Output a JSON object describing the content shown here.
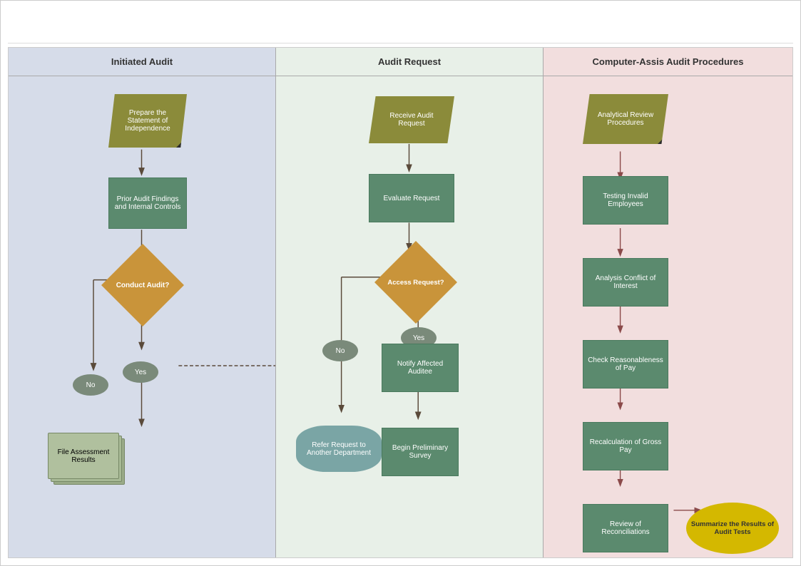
{
  "diagram": {
    "lanes": [
      {
        "id": "initiated",
        "header": "Initiated Audit",
        "color": "#d6dce9"
      },
      {
        "id": "audit-request",
        "header": "Audit Request",
        "color": "#dce8dc"
      },
      {
        "id": "computer",
        "header": "Computer-Assis Audit Procedures",
        "color": "#f2dede"
      }
    ],
    "nodes": {
      "prepare_statement": "Prepare the Statement of Independence",
      "prior_audit": "Prior Audit Findings and Internal Controls",
      "conduct_audit": "Conduct Audit?",
      "no_label": "No",
      "yes_label": "Yes",
      "file_assessment": "File Assessment Results",
      "receive_audit": "Receive Audit Request",
      "evaluate_request": "Evaluate Request",
      "access_request": "Access Request?",
      "no2_label": "No",
      "yes2_label": "Yes",
      "notify_affected": "Notify Affected Auditee",
      "refer_request": "Refer Request to Another Department",
      "begin_preliminary": "Begin Preliminary Survey",
      "analytical_review": "Analytical Review Procedures",
      "testing_invalid": "Testing Invalid Employees",
      "analysis_conflict": "Analysis Conflict of Interest",
      "check_reasonableness": "Check Reasonableness of Pay",
      "recalculation": "Recalculation of Gross Pay",
      "review_reconciliations": "Review of Reconciliations",
      "summarize_results": "Summarize the Results of Audit Tests"
    }
  }
}
